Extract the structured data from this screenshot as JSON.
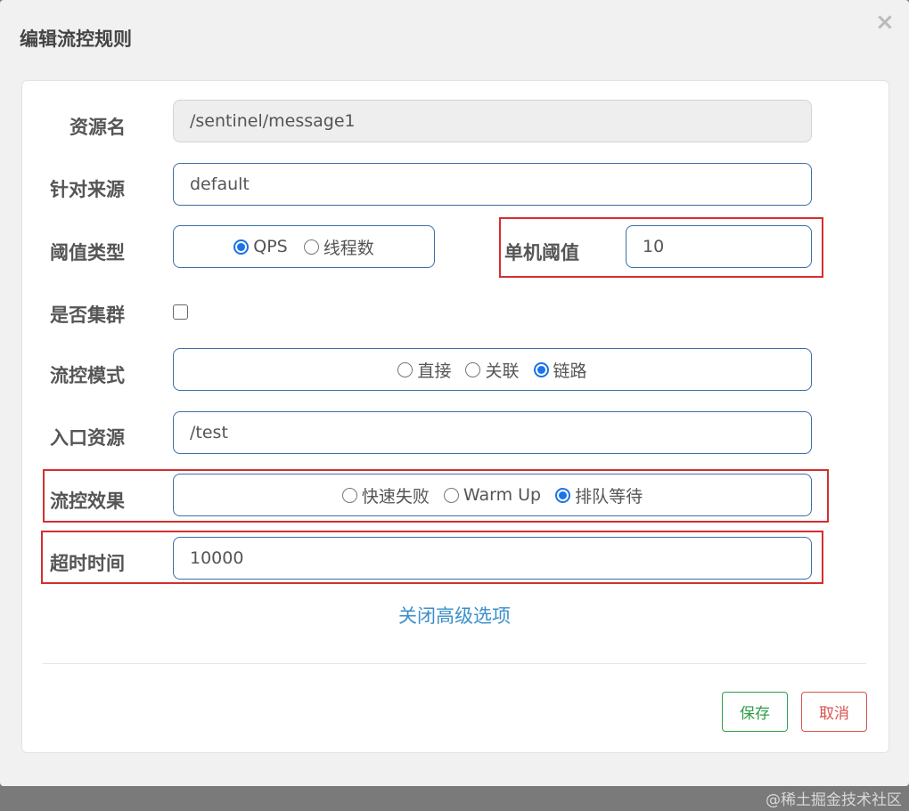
{
  "dialog": {
    "title": "编辑流控规则",
    "close": "×"
  },
  "form": {
    "resource_name": {
      "label": "资源名",
      "value": "/sentinel/message1"
    },
    "limit_app": {
      "label": "针对来源",
      "value": "default"
    },
    "grade": {
      "label": "阈值类型",
      "options": [
        "QPS",
        "线程数"
      ],
      "selected": "QPS"
    },
    "threshold": {
      "label": "单机阈值",
      "value": "10"
    },
    "cluster": {
      "label": "是否集群",
      "checked": false
    },
    "strategy": {
      "label": "流控模式",
      "options": [
        "直接",
        "关联",
        "链路"
      ],
      "selected": "链路"
    },
    "ref_resource": {
      "label": "入口资源",
      "value": "/test"
    },
    "control_behavior": {
      "label": "流控效果",
      "options": [
        "快速失败",
        "Warm Up",
        "排队等待"
      ],
      "selected": "排队等待"
    },
    "timeout": {
      "label": "超时时间",
      "value": "10000"
    },
    "advanced_link": "关闭高级选项"
  },
  "buttons": {
    "save": "保存",
    "cancel": "取消"
  },
  "watermark": "@稀土掘金技术社区",
  "colors": {
    "field_border": "#3a6fa5",
    "highlight_box": "#d32f2f",
    "radio_checked": "#1a73e8",
    "link": "#3b8fc9",
    "save": "#2e9e4b",
    "cancel": "#d9534f"
  }
}
